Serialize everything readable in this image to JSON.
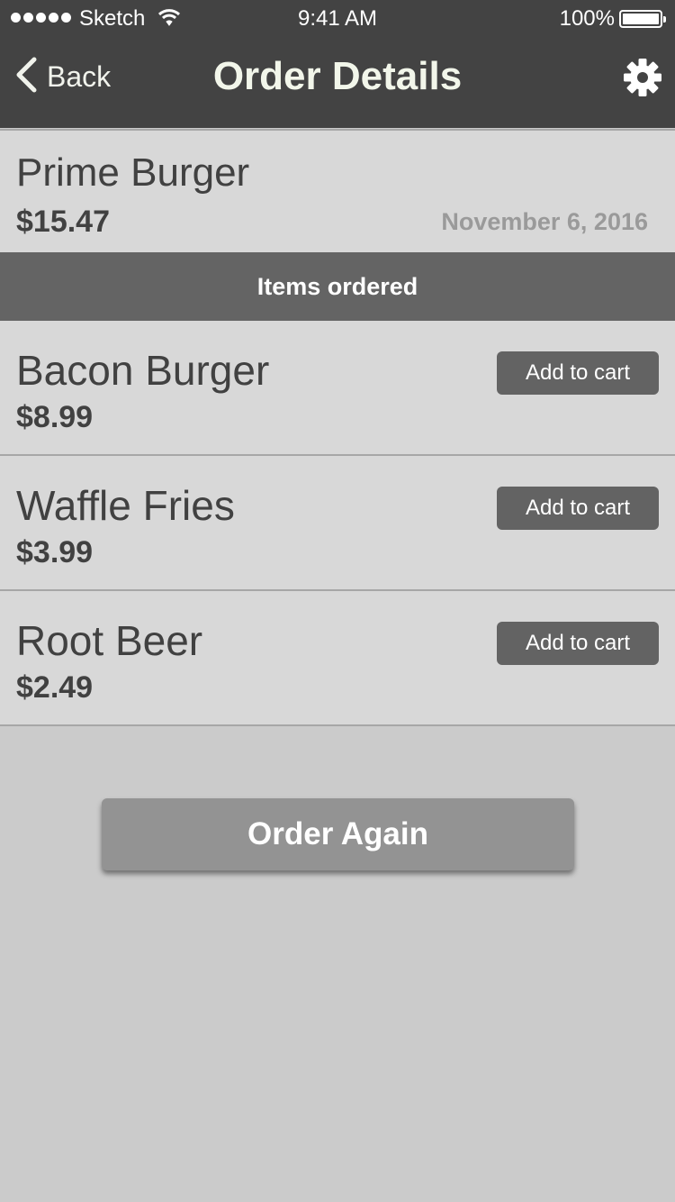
{
  "status_bar": {
    "carrier": "Sketch",
    "time": "9:41 AM",
    "battery_percent": "100%"
  },
  "nav": {
    "back_label": "Back",
    "title": "Order Details",
    "settings_icon": "gear-icon"
  },
  "order": {
    "restaurant": "Prime Burger",
    "total": "$15.47",
    "date": "November 6, 2016"
  },
  "items_header": "Items ordered",
  "items": [
    {
      "name": "Bacon Burger",
      "price": "$8.99",
      "button": "Add to cart"
    },
    {
      "name": "Waffle Fries",
      "price": "$3.99",
      "button": "Add to cart"
    },
    {
      "name": "Root Beer",
      "price": "$2.49",
      "button": "Add to cart"
    }
  ],
  "order_again_label": "Order Again",
  "colors": {
    "nav_background": "#434343",
    "row_background": "#d8d8d8",
    "section_header": "#646464",
    "button": "#636363",
    "order_again": "#939393",
    "page_background": "#cbcbcb"
  }
}
